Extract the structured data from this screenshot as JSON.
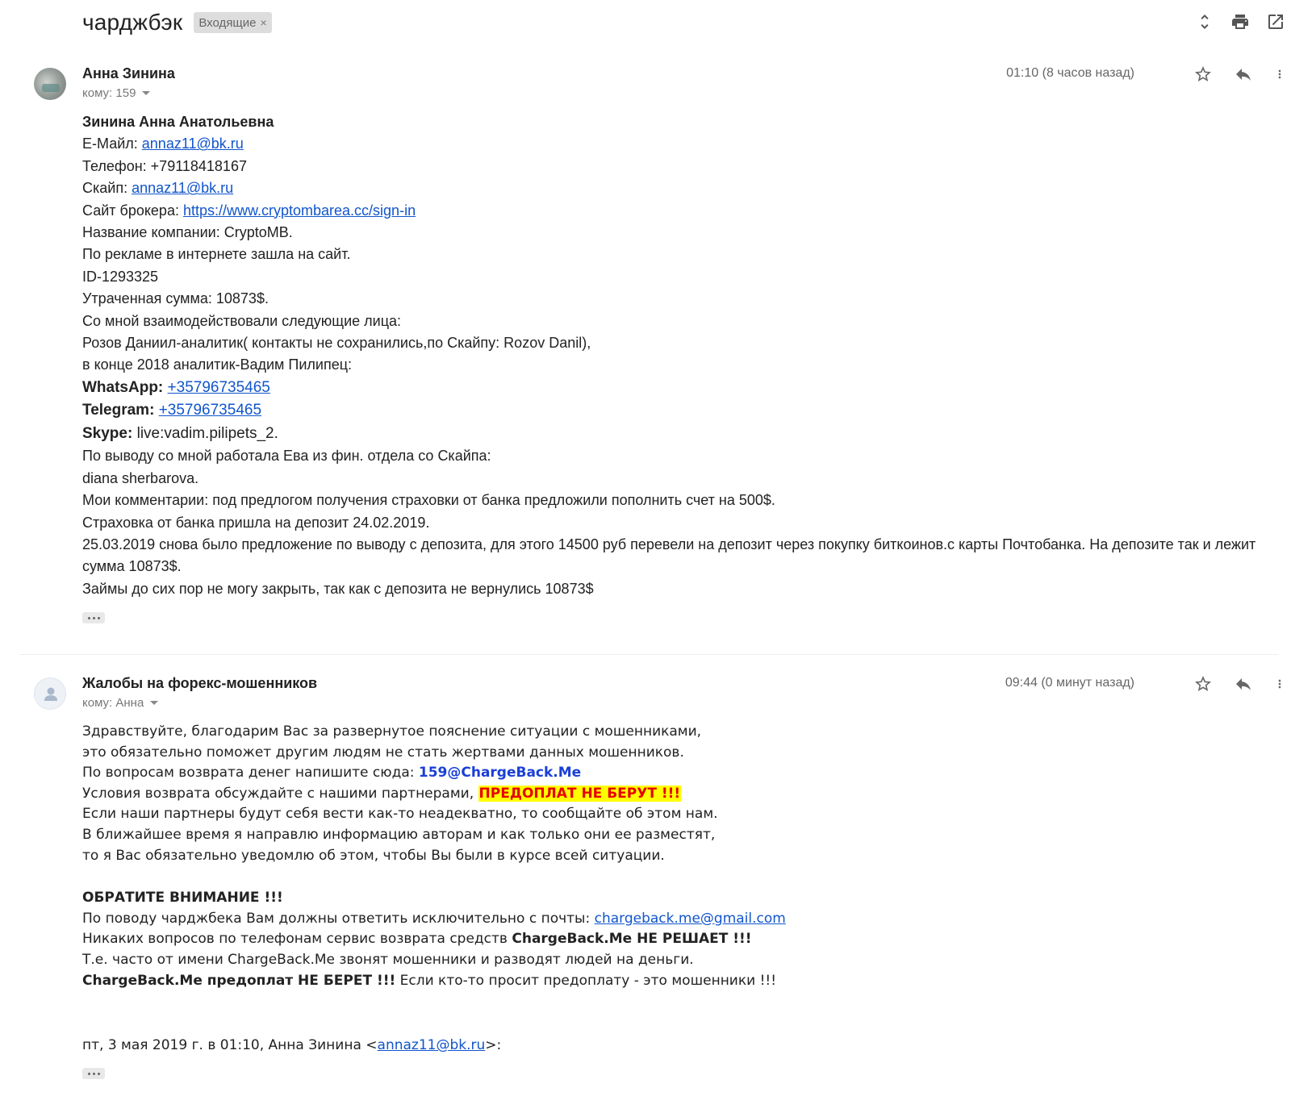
{
  "header": {
    "subject": "чарджбэк",
    "label": "Входящие",
    "label_remove": "×"
  },
  "icons": {
    "expand": "unfold-icon",
    "print": "print-icon",
    "open_new": "open-in-new-window-icon",
    "star": "star-icon",
    "reply": "reply-icon",
    "more": "more-vert-icon"
  },
  "message1": {
    "sender": "Анна Зинина",
    "recipient": "кому: 159",
    "time": "01:10 (8 часов назад)",
    "lines": {
      "name": "Зинина Анна Анатольевна",
      "email_label": "Е-Майл: ",
      "email_value": "annaz11@bk.ru",
      "phone": "Телефон: +79118418167",
      "skype_label": "Скайп: ",
      "skype_value": "annaz11@bk.ru",
      "broker_label": "Сайт брокера: ",
      "broker_url": "https://www.cryptombarea.cc/sign-in",
      "company": "Название компании: CryptoMB.",
      "ad": "По рекламе в интернете зашла на сайт.",
      "id": "ID-1293325",
      "lost": "Утраченная сумма: 10873$.",
      "persons": "Со мной взаимодействовали следующие лица:",
      "rozov": "Розов Даниил-аналитик( контакты не сохранились,по Скайпу: Rozov Danil),",
      "vadim": "в конце 2018 аналитик-Вадим Пилипец:",
      "whatsapp_label": "WhatsApp:",
      "whatsapp_value": "+35796735465",
      "telegram_label": "Telegram:",
      "telegram_value": "+35796735465",
      "skype2_label": "Skype:",
      "skype2_value": " live:vadim.pilipets_2.",
      "eva": "По выводу со мной работала Ева из фин. отдела со Скайпа:",
      "diana": "diana sherbarova.",
      "comments": "Мои комментарии: под предлогом получения страховки от банка предложили пополнить счет на 500$.",
      "insurance": "Страховка от банка пришла на депозит 24.02.2019.",
      "withdraw": "25.03.2019 снова было предложение по выводу с депозита, для этого 14500 руб перевели на депозит через покупку биткоинов.с карты Почтобанка. На депозите так и лежит сумма 10873$.",
      "loans": "Займы до сих пор не могу закрыть, так как с депозита не вернулись 10873$"
    }
  },
  "message2": {
    "sender": "Жалобы на форекс-мошенников",
    "recipient": "кому: Анна",
    "time": "09:44 (0 минут назад)",
    "lines": {
      "greeting": "Здравствуйте, благодарим Вас за развернутое пояснение ситуации с мошенниками,",
      "help": "это обязательно поможет другим людям не стать жертвами данных мошенников.",
      "questions_pre": "По вопросам возврата денег напишите сюда: ",
      "questions_email": "159@ChargeBack.Me",
      "conditions_pre": "Условия возврата обсуждайте с нашими партнерами, ",
      "conditions_warn": "ПРЕДОПЛАТ НЕ БЕРУТ !!!",
      "partners": "Если наши партнеры будут себя вести как-то неадекватно, то сообщайте об этом нам.",
      "soon": "В ближайшее время я направлю информацию авторам и как только они ее разместят,",
      "notify": "то я Вас обязательно уведомлю об этом, чтобы Вы были в курсе всей ситуации.",
      "attention": "ОБРАТИТЕ ВНИМАНИЕ !!!",
      "chargeback_pre": "По поводу чарджбека Вам должны ответить исключительно с почты: ",
      "chargeback_email": "chargeback.me@gmail.com",
      "phones_pre": "Никаких вопросов по телефонам сервис возврата средств ",
      "phones_bold": "ChargeBack.Me НЕ РЕШАЕТ !!!",
      "scam": "Т.е. часто от имени ChargeBack.Me звонят мошенники и разводят людей на деньги.",
      "prepay_bold": "ChargeBack.Me предоплат НЕ БЕРЕТ !!!",
      "prepay_rest": " Если кто-то просит предоплату - это мошенники !!!",
      "quote_pre": "пт, 3 мая 2019 г. в 01:10, Анна Зинина <",
      "quote_email": "annaz11@bk.ru",
      "quote_post": ">:"
    }
  }
}
